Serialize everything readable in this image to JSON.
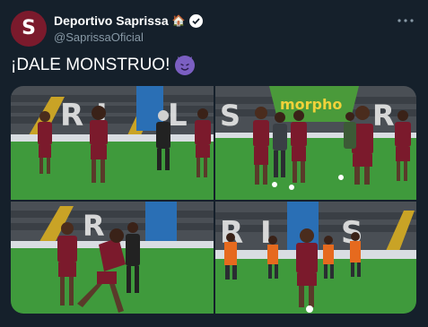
{
  "tweet": {
    "display_name": "Deportivo Saprissa",
    "handle": "@SaprissaOficial",
    "text": "¡DALE MONSTRUO!",
    "avatar_letter": "S",
    "colors": {
      "background": "#15202b",
      "muted": "#8899a6",
      "saprissa_maroon": "#7b1a2c",
      "pitch_green": "#3f9a3c"
    }
  },
  "icons": {
    "more": "more-icon",
    "verified": "verified-badge-icon",
    "house": "house-emoji-icon",
    "devil": "smiling-devil-emoji-icon"
  },
  "photos": {
    "count": 4
  }
}
